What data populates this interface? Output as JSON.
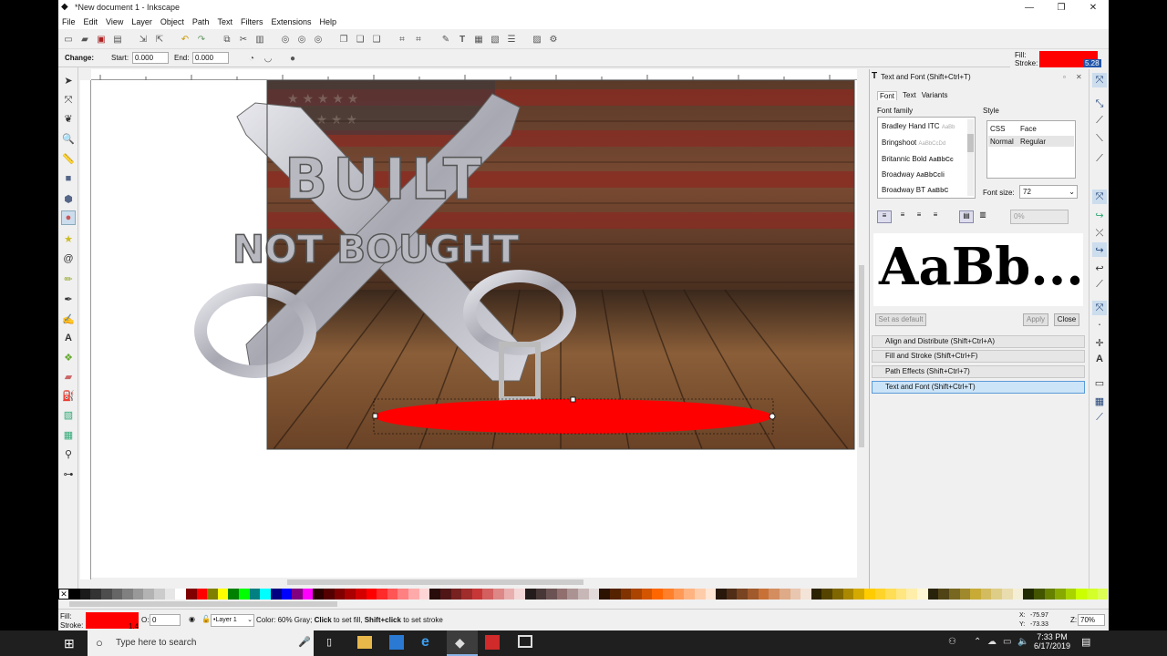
{
  "window": {
    "title": "*New document 1 - Inkscape",
    "minimize": "—",
    "maximize": "❐",
    "close": "✕"
  },
  "menu": [
    "File",
    "Edit",
    "View",
    "Layer",
    "Object",
    "Path",
    "Text",
    "Filters",
    "Extensions",
    "Help"
  ],
  "controls": {
    "change_label": "Change:",
    "start_label": "Start:",
    "start_value": "0.000",
    "end_label": "End:",
    "end_value": "0.000"
  },
  "fill_indicator": {
    "fill_label": "Fill:",
    "stroke_label": "Stroke:",
    "stroke_width": "5.28",
    "fill_color": "#ff0000"
  },
  "artwork": {
    "line1": "BUILT",
    "line2": "NOT BOUGHT",
    "ellipse_color": "#ff0000"
  },
  "text_font_panel": {
    "title": "Text and Font (Shift+Ctrl+T)",
    "tabs": [
      "Font",
      "Text",
      "Variants"
    ],
    "font_family_label": "Font family",
    "fonts": [
      {
        "name": "Bradley Hand ITC",
        "sample": "AaBb"
      },
      {
        "name": "Bringshoot",
        "sample": "AaBbCcDd"
      },
      {
        "name": "Britannic Bold",
        "sample": "AaBbCc"
      },
      {
        "name": "Broadway",
        "sample": "AaBbCcli"
      },
      {
        "name": "Broadway BT",
        "sample": "AaBbC"
      }
    ],
    "style_label": "Style",
    "style_col_css": "CSS",
    "style_col_face": "Face",
    "style_row_css": "Normal",
    "style_row_face": "Regular",
    "font_size_label": "Font size:",
    "font_size_value": "72",
    "spacing_value": "0%",
    "preview": "AaBb...",
    "set_default": "Set as default",
    "apply": "Apply",
    "close": "Close"
  },
  "docked_panels": [
    {
      "label": "Align and Distribute (Shift+Ctrl+A)"
    },
    {
      "label": "Fill and Stroke (Shift+Ctrl+F)"
    },
    {
      "label": "Path Effects  (Shift+Ctrl+7)"
    },
    {
      "label": "Text and Font (Shift+Ctrl+T)"
    }
  ],
  "status": {
    "fill_label": "Fill:",
    "stroke_label": "Stroke:",
    "stroke_width": "1.4",
    "opacity_label": "O:",
    "opacity_value": "0",
    "layer": "•Layer 1",
    "message_prefix": "Color: 60% Gray; ",
    "message_b1": "Click",
    "message_mid": " to set fill, ",
    "message_b2": "Shift+click",
    "message_suffix": " to set stroke",
    "x_label": "X:",
    "x_value": "-75.97",
    "y_label": "Y:",
    "y_value": "-73.33",
    "zoom_label": "Z:",
    "zoom_value": "70%"
  },
  "taskbar": {
    "search_placeholder": "Type here to search",
    "time": "7:33 PM",
    "date": "6/17/2019"
  },
  "palette": [
    "#000000",
    "#1a1a1a",
    "#333333",
    "#4d4d4d",
    "#666666",
    "#808080",
    "#999999",
    "#b3b3b3",
    "#cccccc",
    "#e6e6e6",
    "#ffffff",
    "#800000",
    "#ff0000",
    "#808000",
    "#ffff00",
    "#008000",
    "#00ff00",
    "#008080",
    "#00ffff",
    "#000080",
    "#0000ff",
    "#800080",
    "#ff00ff",
    "#2b0000",
    "#550000",
    "#800000",
    "#aa0000",
    "#d40000",
    "#ff0000",
    "#ff2a2a",
    "#ff5555",
    "#ff8080",
    "#ffaaaa",
    "#ffd5d5",
    "#280b0b",
    "#501616",
    "#782121",
    "#a02c2c",
    "#c83737",
    "#d35f5f",
    "#de8787",
    "#e9afaf",
    "#f4d7d7",
    "#241c1c",
    "#483737",
    "#6c5353",
    "#916f6f",
    "#ac9393",
    "#c8b7b7",
    "#e3dbdb",
    "#2b1100",
    "#552200",
    "#803300",
    "#aa4400",
    "#d45500",
    "#ff6600",
    "#ff7f2a",
    "#ff9955",
    "#ffb380",
    "#ffccaa",
    "#ffe6d5",
    "#28170b",
    "#502d16",
    "#784421",
    "#a05a2c",
    "#c87137",
    "#d38d5f",
    "#deaa87",
    "#e9c6af",
    "#f4e3d7",
    "#2b2200",
    "#554400",
    "#806600",
    "#aa8800",
    "#d4aa00",
    "#ffcc00",
    "#ffd42a",
    "#ffdd55",
    "#ffe680",
    "#ffeeaa",
    "#fff6d5",
    "#28220b",
    "#504416",
    "#786721",
    "#a0892c",
    "#c8ab37",
    "#d3bc5f",
    "#decd87",
    "#e9ddaf",
    "#f4eed7",
    "#222b00",
    "#445500",
    "#668000",
    "#88aa00",
    "#aad400",
    "#ccff00",
    "#d4ff2a",
    "#ddff55"
  ]
}
